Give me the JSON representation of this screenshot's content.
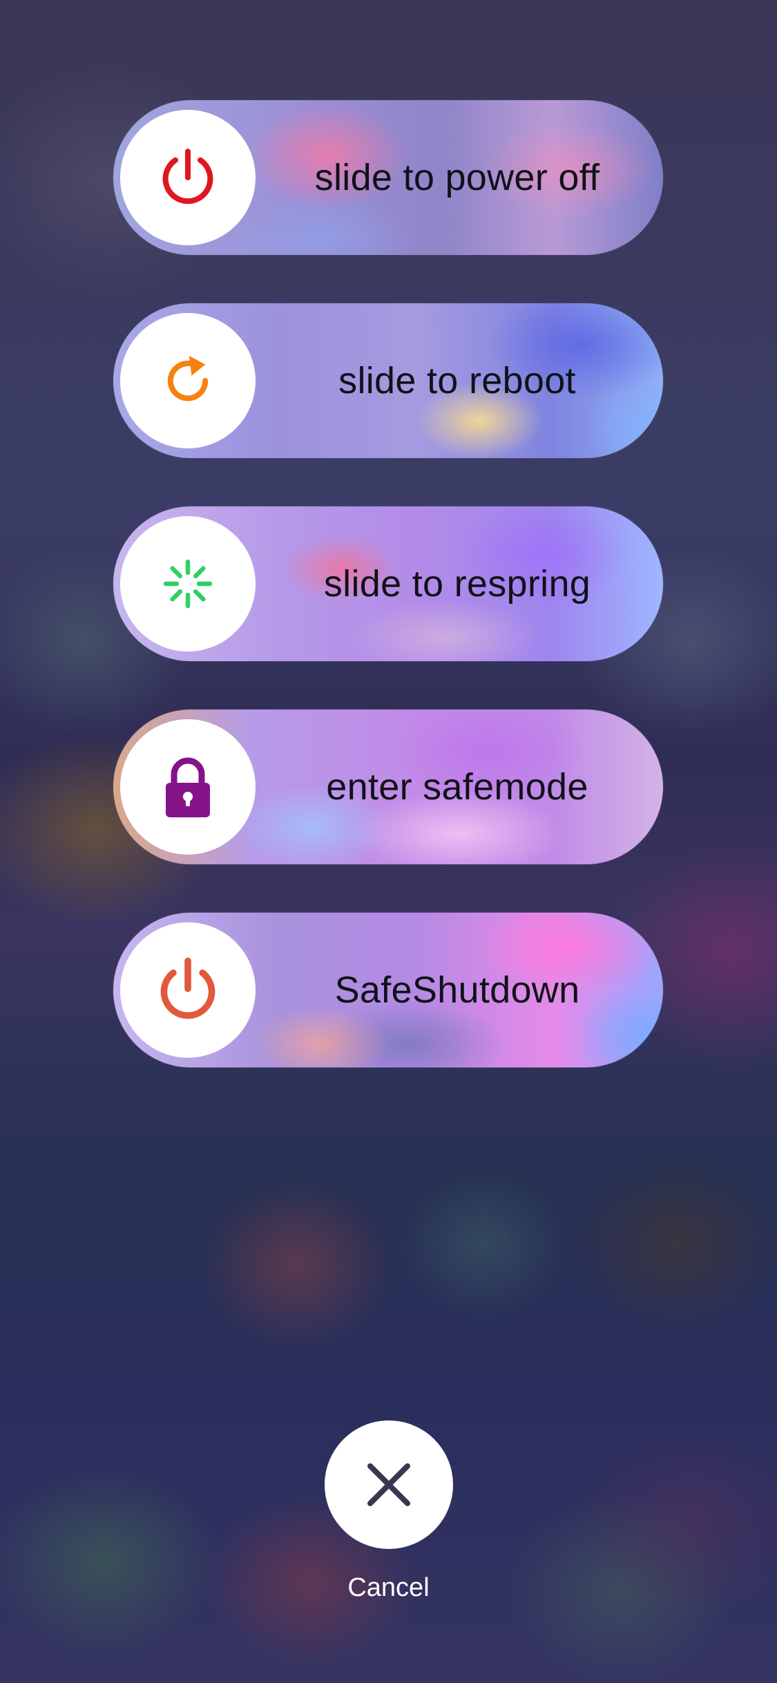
{
  "sliders": [
    {
      "label": "slide to power off",
      "icon": "power-icon",
      "icon_color": "#e0161e"
    },
    {
      "label": "slide to reboot",
      "icon": "reboot-icon",
      "icon_color": "#f5820f"
    },
    {
      "label": "slide to respring",
      "icon": "spinner-icon",
      "icon_color": "#2fcf66"
    },
    {
      "label": "enter safemode",
      "icon": "lock-icon",
      "icon_color": "#86128a"
    },
    {
      "label": "SafeShutdown",
      "icon": "power-icon",
      "icon_color": "#e3583c"
    }
  ],
  "cancel": {
    "label": "Cancel",
    "icon": "close-icon",
    "icon_color": "#3a3550"
  }
}
